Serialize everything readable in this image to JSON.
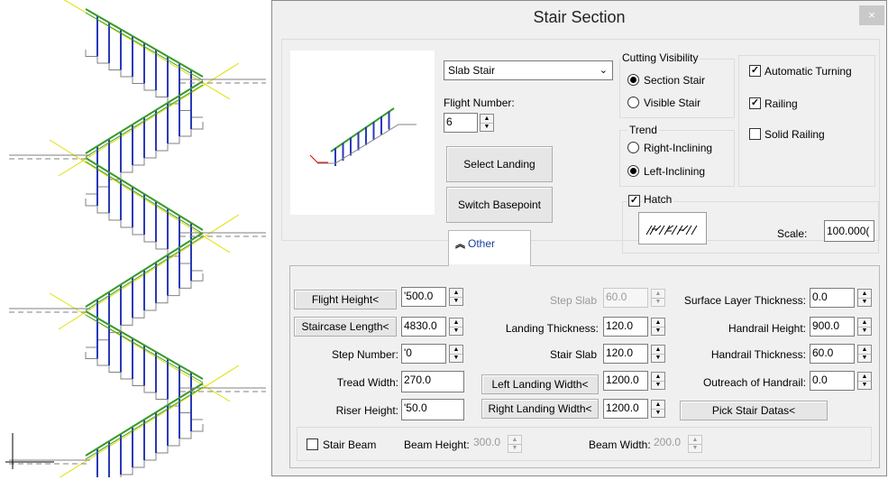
{
  "dialog": {
    "title": "Stair Section",
    "close_glyph": "×"
  },
  "stair_type": {
    "selected": "Slab Stair"
  },
  "flight_number": {
    "label": "Flight Number:",
    "value": "6"
  },
  "buttons": {
    "select_landing": "Select Landing",
    "switch_basepoint": "Switch Basepoint",
    "pick_stair_datas": "Pick Stair Datas<"
  },
  "cutting_visibility": {
    "title": "Cutting Visibility",
    "section_stair": "Section Stair",
    "visible_stair": "Visible Stair"
  },
  "trend": {
    "title": "Trend",
    "right_inclining": "Right-Inclining",
    "left_inclining": "Left-Inclining"
  },
  "options": {
    "automatic_turning": "Automatic Turning",
    "railing": "Railing",
    "solid_railing": "Solid Railing"
  },
  "hatch": {
    "label": "Hatch",
    "scale_label": "Scale:",
    "scale_value": "100.000("
  },
  "tab": {
    "label": "Other",
    "icon": "double-chevron-up-icon"
  },
  "params": {
    "flight_height": {
      "label": "Flight Height<",
      "value": "'500.0"
    },
    "staircase_length": {
      "label": "Staircase Length<",
      "value": "4830.0"
    },
    "step_number": {
      "label": "Step Number:",
      "value": "'0"
    },
    "tread_width": {
      "label": "Tread Width:",
      "value": "270.0"
    },
    "riser_height": {
      "label": "Riser Height:",
      "value": "'50.0"
    },
    "step_slab": {
      "label": "Step Slab",
      "value": "60.0"
    },
    "landing_thickness": {
      "label": "Landing Thickness:",
      "value": "120.0"
    },
    "stair_slab": {
      "label": "Stair Slab",
      "value": "120.0"
    },
    "left_landing_width": {
      "label": "Left Landing Width<",
      "value": "1200.0"
    },
    "right_landing_width": {
      "label": "Right Landing Width<",
      "value": "1200.0"
    },
    "surface_layer_thickness": {
      "label": "Surface Layer Thickness:",
      "value": "0.0"
    },
    "handrail_height": {
      "label": "Handrail Height:",
      "value": "900.0"
    },
    "handrail_thickness": {
      "label": "Handrail Thickness:",
      "value": "60.0"
    },
    "outreach_of_handrail": {
      "label": "Outreach of Handrail:",
      "value": "0.0"
    }
  },
  "beam": {
    "stair_beam": "Stair Beam",
    "beam_height_label": "Beam Height:",
    "beam_height_value": "300.0",
    "beam_width_label": "Beam Width:",
    "beam_width_value": "200.0"
  },
  "colors": {
    "railing_green": "#3a9a28",
    "baluster_blue": "#2a3ab8",
    "guide_yellow": "#e0e000",
    "stair_grey": "#808080"
  }
}
